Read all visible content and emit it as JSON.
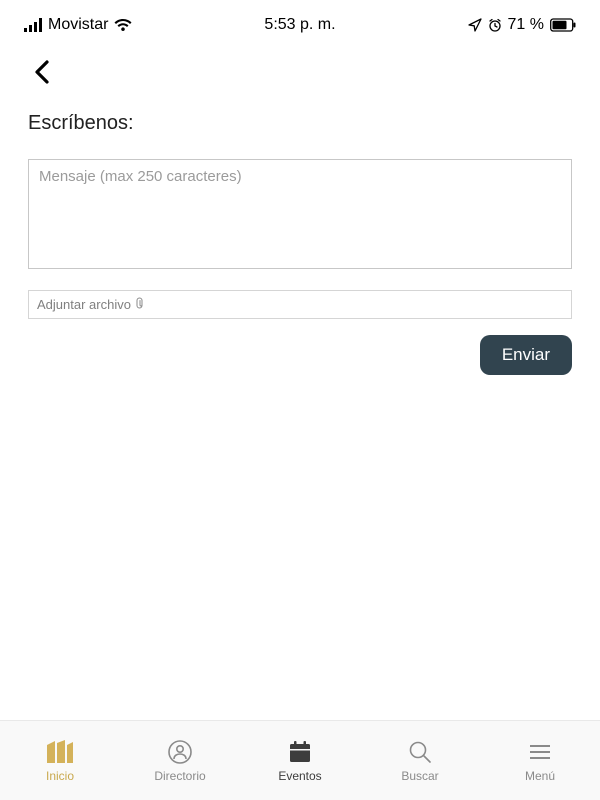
{
  "statusbar": {
    "carrier": "Movistar",
    "time": "5:53 p. m.",
    "battery_pct": "71 %"
  },
  "header": {
    "title": "Escríbenos:"
  },
  "form": {
    "message_placeholder": "Mensaje (max 250 caracteres)",
    "attach_label": "Adjuntar archivo",
    "send_label": "Enviar"
  },
  "tabs": {
    "home": "Inicio",
    "directory": "Directorio",
    "events": "Eventos",
    "search": "Buscar",
    "menu": "Menú"
  }
}
